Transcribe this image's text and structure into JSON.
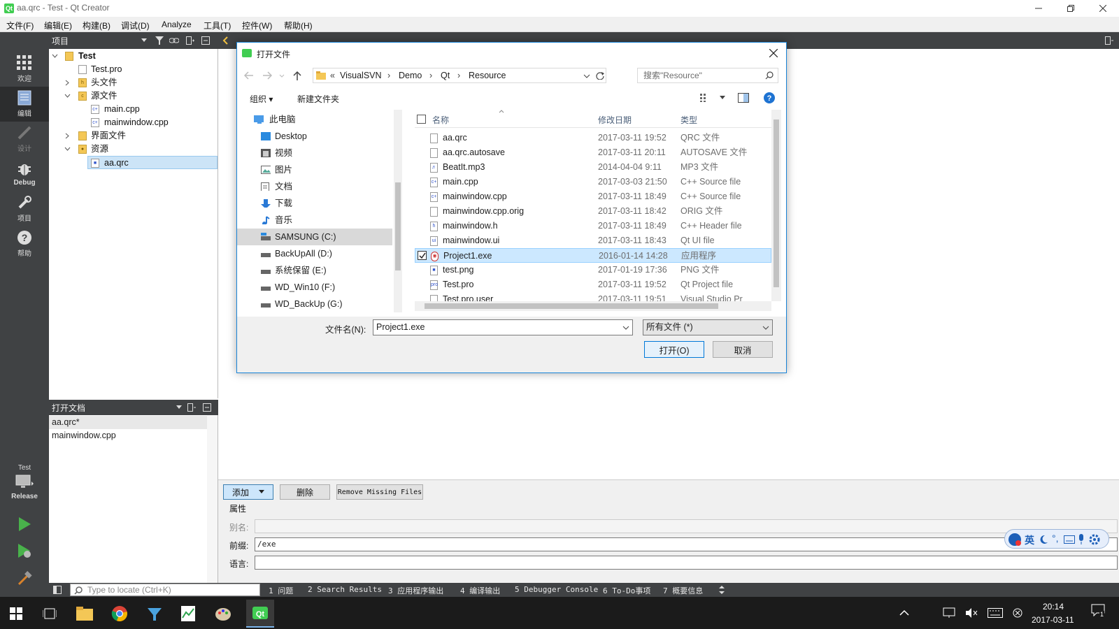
{
  "window": {
    "title": "aa.qrc - Test - Qt Creator",
    "app_icon": "Qt",
    "controls": [
      "minimize-icon",
      "restore-icon",
      "close-icon"
    ]
  },
  "menubar": [
    "文件(F)",
    "编辑(E)",
    "构建(B)",
    "调试(D)",
    "Analyze",
    "工具(T)",
    "控件(W)",
    "帮助(H)"
  ],
  "modes": [
    {
      "label": "欢迎",
      "icon": "grid-icon"
    },
    {
      "label": "编辑",
      "icon": "edit-document-icon"
    },
    {
      "label": "设计",
      "icon": "pencil-icon"
    },
    {
      "label": "Debug",
      "icon": "bug-icon"
    },
    {
      "label": "项目",
      "icon": "wrench-icon"
    },
    {
      "label": "帮助",
      "icon": "help-icon"
    }
  ],
  "kit": {
    "project": "Test",
    "config": "Release"
  },
  "projects_pane": {
    "title": "项目",
    "tree": [
      {
        "label": "Test",
        "level": 0,
        "icon": "qt-project-icon",
        "expanded": true,
        "bold": true
      },
      {
        "label": "Test.pro",
        "level": 1,
        "icon": "pro-file-icon"
      },
      {
        "label": "头文件",
        "level": 1,
        "icon": "header-folder-icon",
        "expanded": false
      },
      {
        "label": "源文件",
        "level": 1,
        "icon": "source-folder-icon",
        "expanded": true
      },
      {
        "label": "main.cpp",
        "level": 2,
        "icon": "cpp-file-icon"
      },
      {
        "label": "mainwindow.cpp",
        "level": 2,
        "icon": "cpp-file-icon"
      },
      {
        "label": "界面文件",
        "level": 1,
        "icon": "forms-folder-icon",
        "expanded": false
      },
      {
        "label": "资源",
        "level": 1,
        "icon": "resources-folder-icon",
        "expanded": true
      },
      {
        "label": "aa.qrc",
        "level": 2,
        "icon": "qrc-file-icon",
        "selected": true
      }
    ]
  },
  "open_documents": {
    "title": "打开文档",
    "items": [
      "aa.qrc*",
      "mainwindow.cpp"
    ]
  },
  "resource_editor": {
    "buttons": {
      "add": "添加",
      "remove": "删除",
      "remove_missing": "Remove Missing Files"
    },
    "properties_title": "属性",
    "alias_label": "别名:",
    "alias_value": "",
    "prefix_label": "前缀:",
    "prefix_value": "/exe",
    "lang_label": "语言:",
    "lang_value": ""
  },
  "locator": {
    "placeholder": "Type to locate (Ctrl+K)"
  },
  "output_tabs": [
    "1  问题",
    "2  Search Results",
    "3  应用程序输出",
    "4  编译输出",
    "5  Debugger Console",
    "6  To-Do事项",
    "7  概要信息"
  ],
  "dialog": {
    "title": "打开文件",
    "breadcrumb": [
      "VisualSVN",
      "Demo",
      "Qt",
      "Resource"
    ],
    "breadcrumb_prefix": "«",
    "search_placeholder": "搜索\"Resource\"",
    "organize": "组织 ▾",
    "new_folder": "新建文件夹",
    "nav": [
      {
        "label": "此电脑",
        "icon": "computer-icon",
        "indent": 0
      },
      {
        "label": "Desktop",
        "icon": "desktop-icon",
        "indent": 1
      },
      {
        "label": "视频",
        "icon": "video-icon",
        "indent": 1
      },
      {
        "label": "图片",
        "icon": "pictures-icon",
        "indent": 1
      },
      {
        "label": "文档",
        "icon": "documents-icon",
        "indent": 1
      },
      {
        "label": "下载",
        "icon": "download-icon",
        "indent": 1
      },
      {
        "label": "音乐",
        "icon": "music-icon",
        "indent": 1
      },
      {
        "label": "SAMSUNG (C:)",
        "icon": "drive-icon",
        "indent": 1,
        "selected": true
      },
      {
        "label": "BackUpAll (D:)",
        "icon": "drive-icon",
        "indent": 1
      },
      {
        "label": "系统保留 (E:)",
        "icon": "drive-icon",
        "indent": 1
      },
      {
        "label": "WD_Win10 (F:)",
        "icon": "drive-icon",
        "indent": 1
      },
      {
        "label": "WD_BackUp (G:)",
        "icon": "drive-icon",
        "indent": 1
      }
    ],
    "columns": [
      "名称",
      "修改日期",
      "类型"
    ],
    "files": [
      {
        "name": "aa.qrc",
        "date": "2017-03-11 19:52",
        "type": "QRC 文件",
        "icon": "file-icon"
      },
      {
        "name": "aa.qrc.autosave",
        "date": "2017-03-11 20:11",
        "type": "AUTOSAVE 文件",
        "icon": "file-icon"
      },
      {
        "name": "BeatIt.mp3",
        "date": "2014-04-04 9:11",
        "type": "MP3 文件",
        "icon": "audio-file-icon"
      },
      {
        "name": "main.cpp",
        "date": "2017-03-03 21:50",
        "type": "C++ Source file",
        "icon": "cpp-file-icon"
      },
      {
        "name": "mainwindow.cpp",
        "date": "2017-03-11 18:49",
        "type": "C++ Source file",
        "icon": "cpp-file-icon"
      },
      {
        "name": "mainwindow.cpp.orig",
        "date": "2017-03-11 18:42",
        "type": "ORIG 文件",
        "icon": "file-icon"
      },
      {
        "name": "mainwindow.h",
        "date": "2017-03-11 18:49",
        "type": "C++ Header file",
        "icon": "header-file-icon"
      },
      {
        "name": "mainwindow.ui",
        "date": "2017-03-11 18:43",
        "type": "Qt UI file",
        "icon": "ui-file-icon"
      },
      {
        "name": "Project1.exe",
        "date": "2016-01-14 14:28",
        "type": "应用程序",
        "icon": "exe-icon",
        "selected": true
      },
      {
        "name": "test.png",
        "date": "2017-01-19 17:36",
        "type": "PNG 文件",
        "icon": "image-file-icon"
      },
      {
        "name": "Test.pro",
        "date": "2017-03-11 19:52",
        "type": "Qt Project file",
        "icon": "pro-file-icon"
      },
      {
        "name": "Test.pro.user",
        "date": "2017-03-11 19:51",
        "type": "Visual Studio Pr",
        "icon": "file-icon"
      }
    ],
    "filename_label": "文件名(N):",
    "filename_value": "Project1.exe",
    "filter_value": "所有文件 (*)",
    "open_button": "打开(O)",
    "cancel_button": "取消"
  },
  "ime": {
    "lang": "英"
  },
  "taskbar": {
    "time": "20:14",
    "date": "2017-03-11",
    "notification_count": "1"
  }
}
